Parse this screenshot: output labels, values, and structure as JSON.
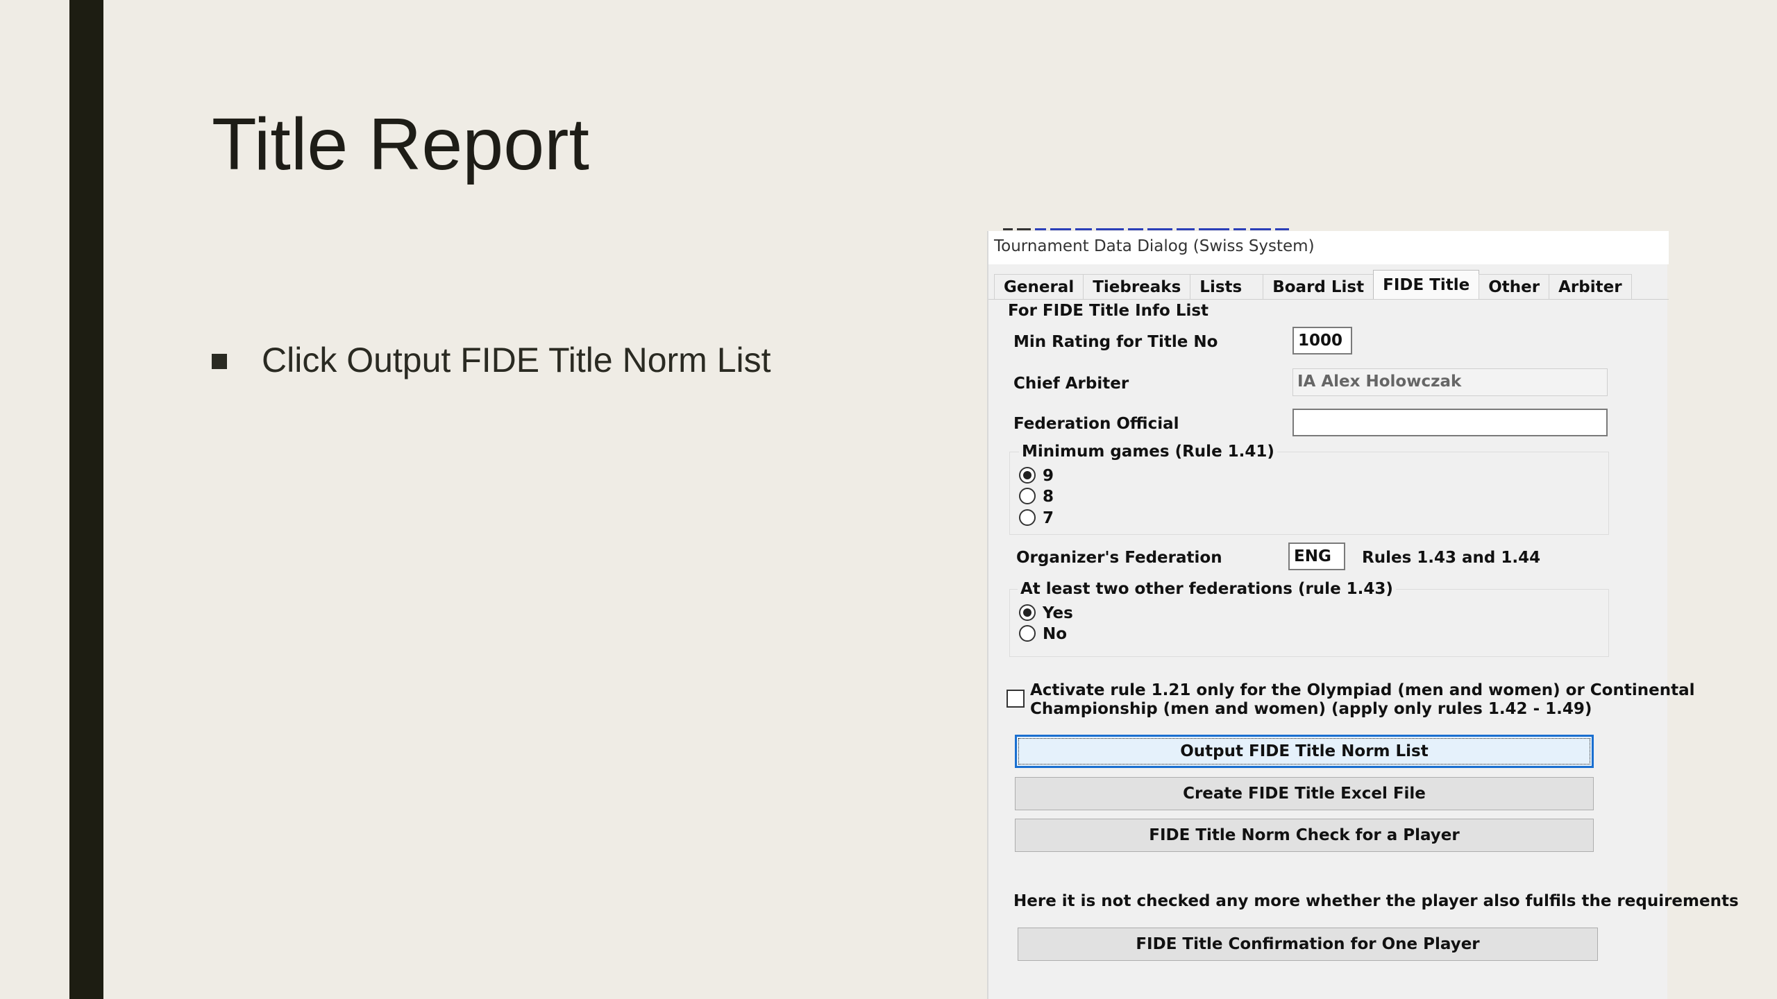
{
  "slide": {
    "title": "Title Report",
    "bullet": "Click Output FIDE Title Norm List"
  },
  "dialog": {
    "title": "Tournament Data Dialog (Swiss System)",
    "tabs": [
      {
        "label": "General"
      },
      {
        "label": "Tiebreaks"
      },
      {
        "label": "Lists"
      },
      {
        "label": "Board List"
      },
      {
        "label": "FIDE Title"
      },
      {
        "label": "Other"
      },
      {
        "label": "Arbiter"
      }
    ],
    "active_tab": "FIDE Title",
    "section_label": "For FIDE Title Info List",
    "min_rating": {
      "label": "Min Rating for Title No",
      "value": "1000"
    },
    "chief_arbiter": {
      "label": "Chief Arbiter",
      "value": "IA Alex Holowczak"
    },
    "federation_official": {
      "label": "Federation Official",
      "value": ""
    },
    "min_games": {
      "label": "Minimum games (Rule 1.41)",
      "options": [
        "9",
        "8",
        "7"
      ],
      "selected": "9"
    },
    "organizer_federation": {
      "label": "Organizer's Federation",
      "value": "ENG",
      "note": "Rules 1.43 and 1.44"
    },
    "two_federations": {
      "label": "At least two other federations (rule 1.43)",
      "options": [
        "Yes",
        "No"
      ],
      "selected": "Yes"
    },
    "activate_rule": {
      "line1": "Activate rule 1.21 only for the Olympiad (men and women) or Continental",
      "line2": "Championship (men and women)  (apply only rules 1.42 - 1.49)",
      "checked": false
    },
    "buttons": {
      "output_norm_list": "Output FIDE Title Norm List",
      "create_excel": "Create FIDE Title Excel File",
      "norm_check": "FIDE Title Norm Check for a Player",
      "confirmation": "FIDE Title Confirmation for One Player"
    },
    "note": "Here it is not checked any more whether the player also fulfils the requirements"
  },
  "colors": {
    "slide_background": "#efece5",
    "accent_bar": "#1d1d12",
    "focus_border": "#1a6fd0"
  }
}
